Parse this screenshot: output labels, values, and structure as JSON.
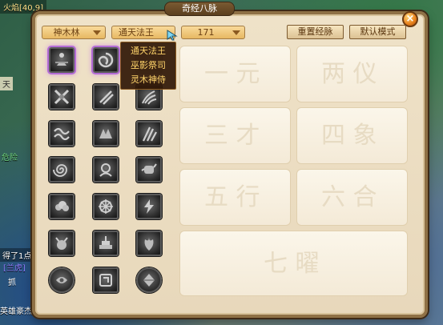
{
  "scene": {
    "top_text": "火焰[40,9]",
    "left_text_1": "天",
    "left_text_2": "危险",
    "left_text_3": "得了1点灵",
    "left_text_4": "[兰虎]",
    "left_text_5": "抓",
    "left_text_6": "英雄豪杰"
  },
  "window": {
    "title": "奇经八脉",
    "close_label": "×"
  },
  "controls": {
    "dropdown_tree": "神木林",
    "dropdown_branch": "通天法王",
    "dropdown_points": "171",
    "reset_button": "重置经脉",
    "default_mode_button": "默认模式"
  },
  "menu": {
    "options": [
      "通天法王",
      "巫影祭司",
      "灵木神侍"
    ]
  },
  "skills": [
    {
      "icon": "meditation-icon"
    },
    {
      "icon": "vortex-icon"
    },
    {
      "icon": "blank-icon"
    },
    {
      "icon": "crossed-blades-icon"
    },
    {
      "icon": "slash-icon"
    },
    {
      "icon": "talon-icon"
    },
    {
      "icon": "wave-icon"
    },
    {
      "icon": "beast-icon"
    },
    {
      "icon": "claw-strike-icon"
    },
    {
      "icon": "swirl-icon"
    },
    {
      "icon": "spirit-icon"
    },
    {
      "icon": "fist-icon"
    },
    {
      "icon": "cloud-icon"
    },
    {
      "icon": "wheel-icon"
    },
    {
      "icon": "lightning-icon"
    },
    {
      "icon": "demon-icon"
    },
    {
      "icon": "altar-icon"
    },
    {
      "icon": "phoenix-icon"
    },
    {
      "icon": "orb-icon"
    },
    {
      "icon": "seal-icon"
    },
    {
      "icon": "gem-icon"
    }
  ],
  "slots": {
    "slot_glyphs": [
      "一 元",
      "两 仪",
      "三 才",
      "四 象",
      "五 行",
      "六 合",
      "七 曜"
    ]
  }
}
